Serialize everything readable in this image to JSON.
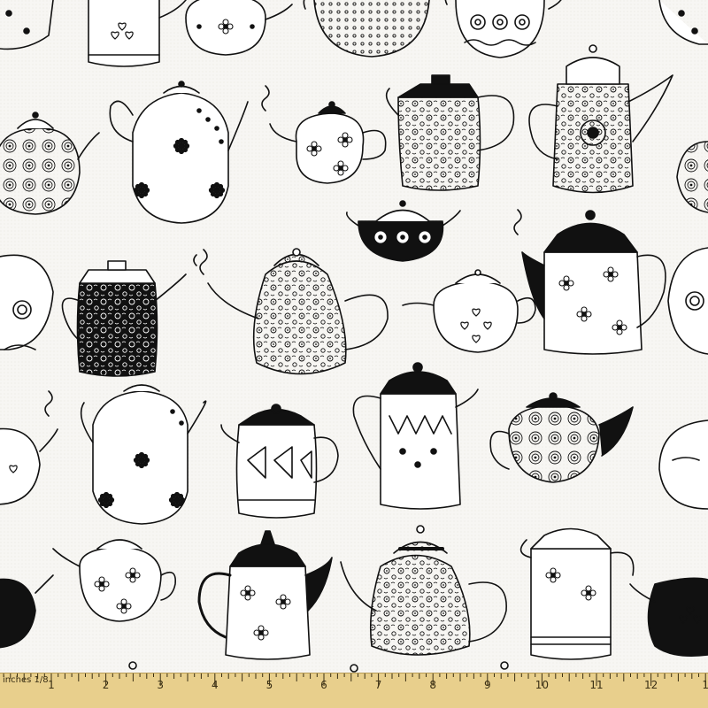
{
  "ruler": {
    "unit_label": "inches 1/8",
    "numbers": [
      "1",
      "2",
      "3",
      "4",
      "5",
      "6",
      "7",
      "8",
      "9",
      "10",
      "11",
      "12",
      "1"
    ]
  },
  "colors": {
    "fabric": "#f7f6f3",
    "ink": "#111111",
    "ruler": "#e8cf8c"
  }
}
